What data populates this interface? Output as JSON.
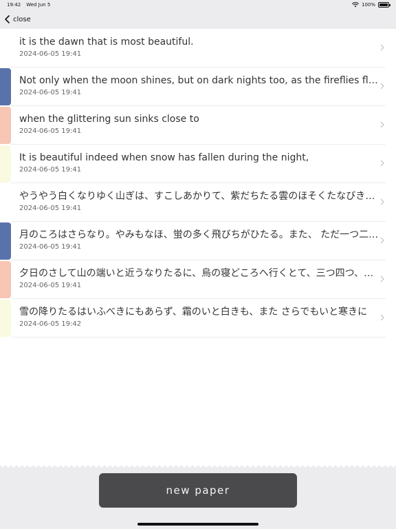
{
  "status_bar": {
    "time": "19:42",
    "date": "Wed Jun 5",
    "battery": "100%",
    "battery_level": 1.0
  },
  "nav": {
    "back_label": "close",
    "back_icon": "chevron-left-icon"
  },
  "colors": {
    "blue": "#5a72aa",
    "peach": "#f7c6b4",
    "cream": "#fafae0",
    "button_bg": "#4a494b"
  },
  "items": [
    {
      "title": "it is the dawn that is most beautiful.",
      "date": "2024-06-05 19:41",
      "color": ""
    },
    {
      "title": "Not only when the moon shines, but on dark nights too, as the fireflies flit to and fro",
      "date": "2024-06-05 19:41",
      "color": "#5a72aa"
    },
    {
      "title": "when the glittering sun sinks close to",
      "date": "2024-06-05 19:41",
      "color": "#f7c6b4"
    },
    {
      "title": "It is beautiful indeed when snow has fallen during the night,",
      "date": "2024-06-05 19:41",
      "color": "#fafae0"
    },
    {
      "title": "やうやう白くなりゆく山ぎは、すこしあかりて、紫だちたる雲のほそくたなびきたる。",
      "date": "2024-06-05 19:41",
      "color": ""
    },
    {
      "title": "月のころはさらなり。やみもなほ、蛍の多く飛びちがひたる。また、 ただ一つ二つなど",
      "date": "2024-06-05 19:41",
      "color": "#5a72aa"
    },
    {
      "title": "夕日のさして山の端いと近うなりたるに、烏の寝どころへ行くとて、三つ四つ、二つ三つなど",
      "date": "2024-06-05 19:41",
      "color": "#f7c6b4"
    },
    {
      "title": "雪の降りたるはいふべきにもあらず、霜のいと白きも、また さらでもいと寒きに",
      "date": "2024-06-05 19:42",
      "color": "#fafae0"
    }
  ],
  "button": {
    "label": "new paper"
  }
}
